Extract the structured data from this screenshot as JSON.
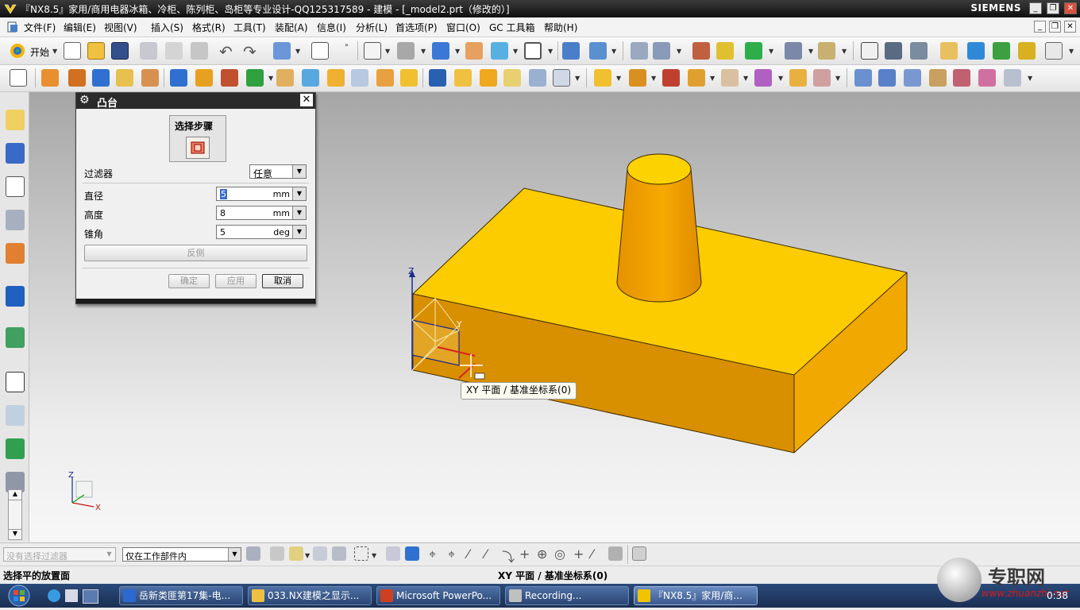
{
  "window": {
    "title": "『NX8.5』家用/商用电器冰箱、冷柜、陈列柜、岛柜等专业设计-QQ125317589 - 建模 - [_model2.prt（修改的）]",
    "brand": "SIEMENS",
    "controls": [
      "_",
      "❐",
      "✕"
    ]
  },
  "menu": {
    "items": [
      "文件(F)",
      "编辑(E)",
      "视图(V)",
      "插入(S)",
      "格式(R)",
      "工具(T)",
      "装配(A)",
      "信息(I)",
      "分析(L)",
      "首选项(P)",
      "窗口(O)",
      "GC 工具箱",
      "帮助(H)"
    ],
    "mdi_controls": [
      "_",
      "❐",
      "✕"
    ]
  },
  "toolbar": {
    "start_label": "开始"
  },
  "dialog": {
    "title": "凸台",
    "select_step_label": "选择步骤",
    "filter_label": "过滤器",
    "filter_value": "任意",
    "diameter_label": "直径",
    "diameter_value": "5",
    "diameter_unit": "mm",
    "height_label": "高度",
    "height_value": "8",
    "height_unit": "mm",
    "taper_label": "锥角",
    "taper_value": "5",
    "taper_unit": "deg",
    "reverse_label": "反侧",
    "ok_label": "确定",
    "apply_label": "应用",
    "cancel_label": "取消"
  },
  "viewport": {
    "tooltip": "XY 平面 / 基准坐标系(0)",
    "axis_z": "Z",
    "axis_y": "Y",
    "axis_x": "X",
    "colors": {
      "top": "#fccb00",
      "front": "#d88f00",
      "side": "#f1a800",
      "cylinder": "#f2a100",
      "cylinder_top": "#fcd200"
    }
  },
  "selection_bar": {
    "filter_placeholder": "没有选择过滤器",
    "scope_value": "仅在工作部件内"
  },
  "status": {
    "prompt": "选择平的放置面",
    "message": "XY 平面 / 基准坐标系(0)"
  },
  "taskbar": {
    "tasks": [
      "岳新类匪第17集-电...",
      "033.NX建模之显示...",
      "Microsoft PowerPo...",
      "Recording...",
      "『NX8.5』家用/商..."
    ],
    "clock": "0:38",
    "watermark_text": "专职网",
    "watermark_url": "www.zhuanzhi.net"
  }
}
